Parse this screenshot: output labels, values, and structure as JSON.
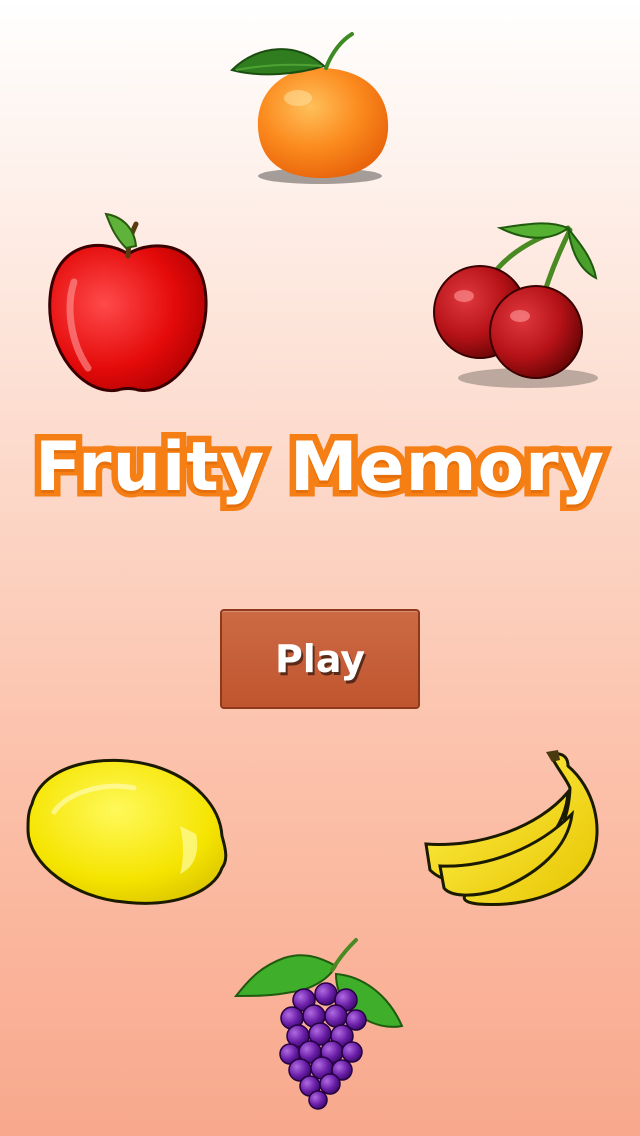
{
  "title": "Fruity Memory",
  "play_button": {
    "label": "Play"
  },
  "fruits": [
    "orange",
    "apple",
    "cherries",
    "lemon",
    "banana",
    "grapes"
  ],
  "colors": {
    "title_fill": "#ffffff",
    "title_outline": "#f57f14",
    "button_bg": "#c0552f",
    "button_border": "#8e3a1a"
  }
}
